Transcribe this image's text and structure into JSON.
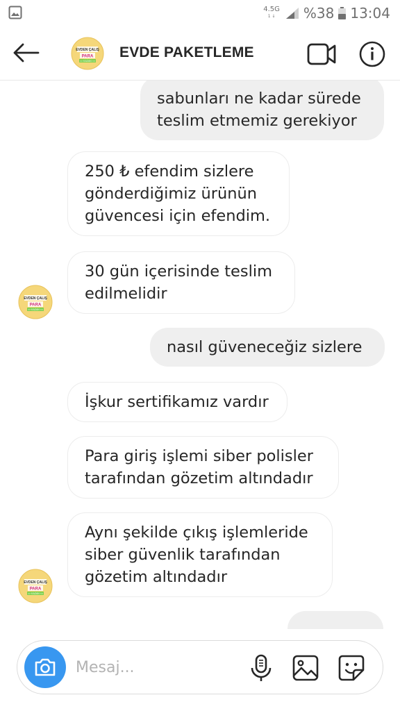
{
  "status_bar": {
    "network": "4.5G",
    "network_sub": "1 ↓",
    "battery_percent": "%38",
    "time": "13:04",
    "icons": [
      "image-notification-icon",
      "signal-icon",
      "battery-icon"
    ]
  },
  "header": {
    "title": "EVDE PAKETLEME",
    "back_icon": "back-arrow-icon",
    "video_icon": "video-camera-icon",
    "info_icon": "info-icon",
    "avatar_logo_text": [
      "EVDEN ÇALIŞ",
      "PARA",
      ">> KAZAN <<"
    ]
  },
  "messages": [
    {
      "direction": "out",
      "lines": [
        "sabunları ne kadar sürede",
        "teslim etmemiz gerekiyor"
      ]
    },
    {
      "direction": "in",
      "lines": [
        "250 ₺ efendim sizlere",
        "gönderdiğimiz ürünün",
        "güvencesi için efendim."
      ]
    },
    {
      "direction": "in",
      "lines": [
        "30 gün içerisinde teslim",
        "edilmelidir"
      ]
    },
    {
      "direction": "out",
      "lines": [
        "nasıl güveneceğiz sizlere"
      ]
    },
    {
      "direction": "in",
      "lines": [
        "İşkur sertifikamız vardır"
      ]
    },
    {
      "direction": "in",
      "lines": [
        "Para giriş işlemi siber polisler",
        "tarafından gözetim altındadır"
      ]
    },
    {
      "direction": "in",
      "lines": [
        "Aynı şekilde çıkış işlemleride",
        "siber güvenlik tarafından",
        "gözetim altındadır"
      ]
    },
    {
      "direction": "out",
      "lines": [
        "... ..."
      ]
    }
  ],
  "composer": {
    "placeholder": "Mesaj...",
    "value": "",
    "icons": [
      "camera-icon",
      "microphone-icon",
      "gallery-icon",
      "sticker-icon"
    ]
  },
  "colors": {
    "accent_blue": "#3897f0",
    "outgoing_bubble": "#efefef",
    "incoming_border": "#ececec",
    "text": "#262626",
    "avatar_yellow": "#f5d77a"
  }
}
